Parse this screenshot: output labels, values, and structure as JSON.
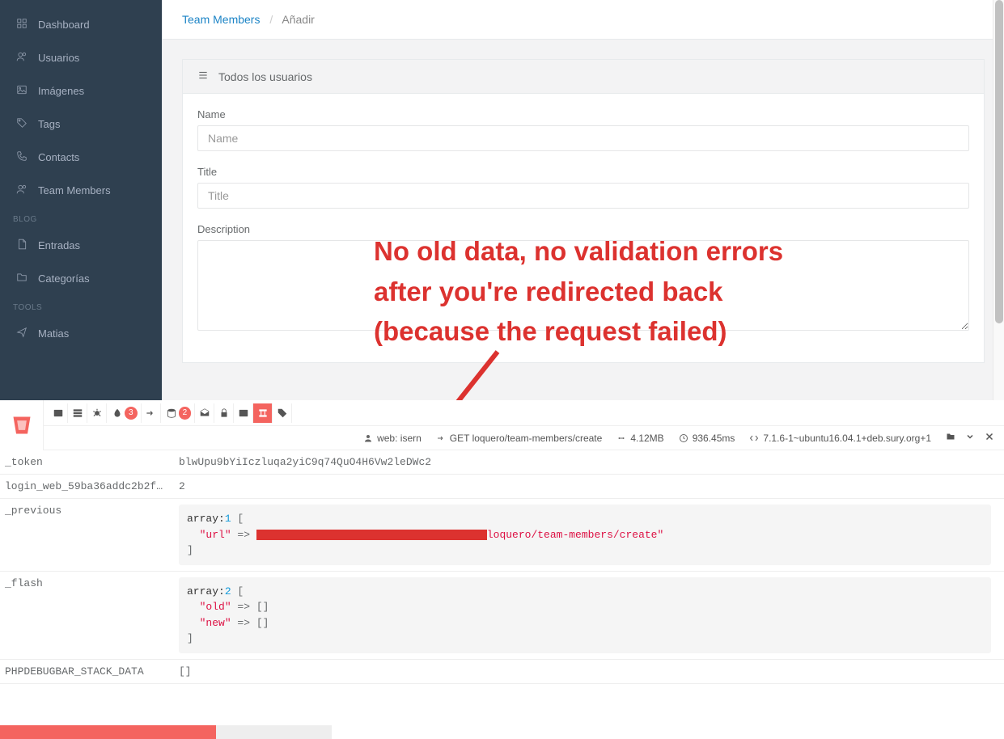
{
  "sidebar": {
    "items": [
      {
        "label": "Dashboard"
      },
      {
        "label": "Usuarios"
      },
      {
        "label": "Imágenes"
      },
      {
        "label": "Tags"
      },
      {
        "label": "Contacts"
      },
      {
        "label": "Team Members"
      }
    ],
    "heading_blog": "BLOG",
    "blog_items": [
      {
        "label": "Entradas"
      },
      {
        "label": "Categorías"
      }
    ],
    "heading_tools": "TOOLS",
    "tool_items": [
      {
        "label": "Matias"
      }
    ]
  },
  "breadcrumb": {
    "root": "Team Members",
    "current": "Añadir"
  },
  "panel": {
    "title": "Todos los usuarios"
  },
  "form": {
    "name_label": "Name",
    "name_placeholder": "Name",
    "title_label": "Title",
    "title_placeholder": "Title",
    "desc_label": "Description"
  },
  "annotation": {
    "line1": "No old data, no validation errors",
    "line2": "after you're redirected back",
    "line3": "(because the request failed)"
  },
  "debugbar": {
    "tabs_badges": {
      "routes": "3",
      "queries": "2"
    },
    "status": {
      "user": "web: isern",
      "request": "GET loquero/team-members/create",
      "memory": "4.12MB",
      "time": "936.45ms",
      "php": "7.1.6-1~ubuntu16.04.1+deb.sury.org+1"
    },
    "session": {
      "token_key": "_token",
      "token_val": "blwUpu9bYiIczluqa2yiC9q74QuO4H6Vw2leDWc2",
      "login_key": "login_web_59ba36addc2b2f…",
      "login_val": "2",
      "previous_key": "_previous",
      "previous_array": "array:",
      "previous_count": "1",
      "previous_url_key": "\"url\"",
      "previous_url_suffix": "loquero/team-members/create\"",
      "flash_key": "_flash",
      "flash_array": "array:",
      "flash_count": "2",
      "flash_old": "\"old\"",
      "flash_new": "\"new\"",
      "stack_key": "PHPDEBUGBAR_STACK_DATA",
      "stack_val": "[]"
    }
  }
}
